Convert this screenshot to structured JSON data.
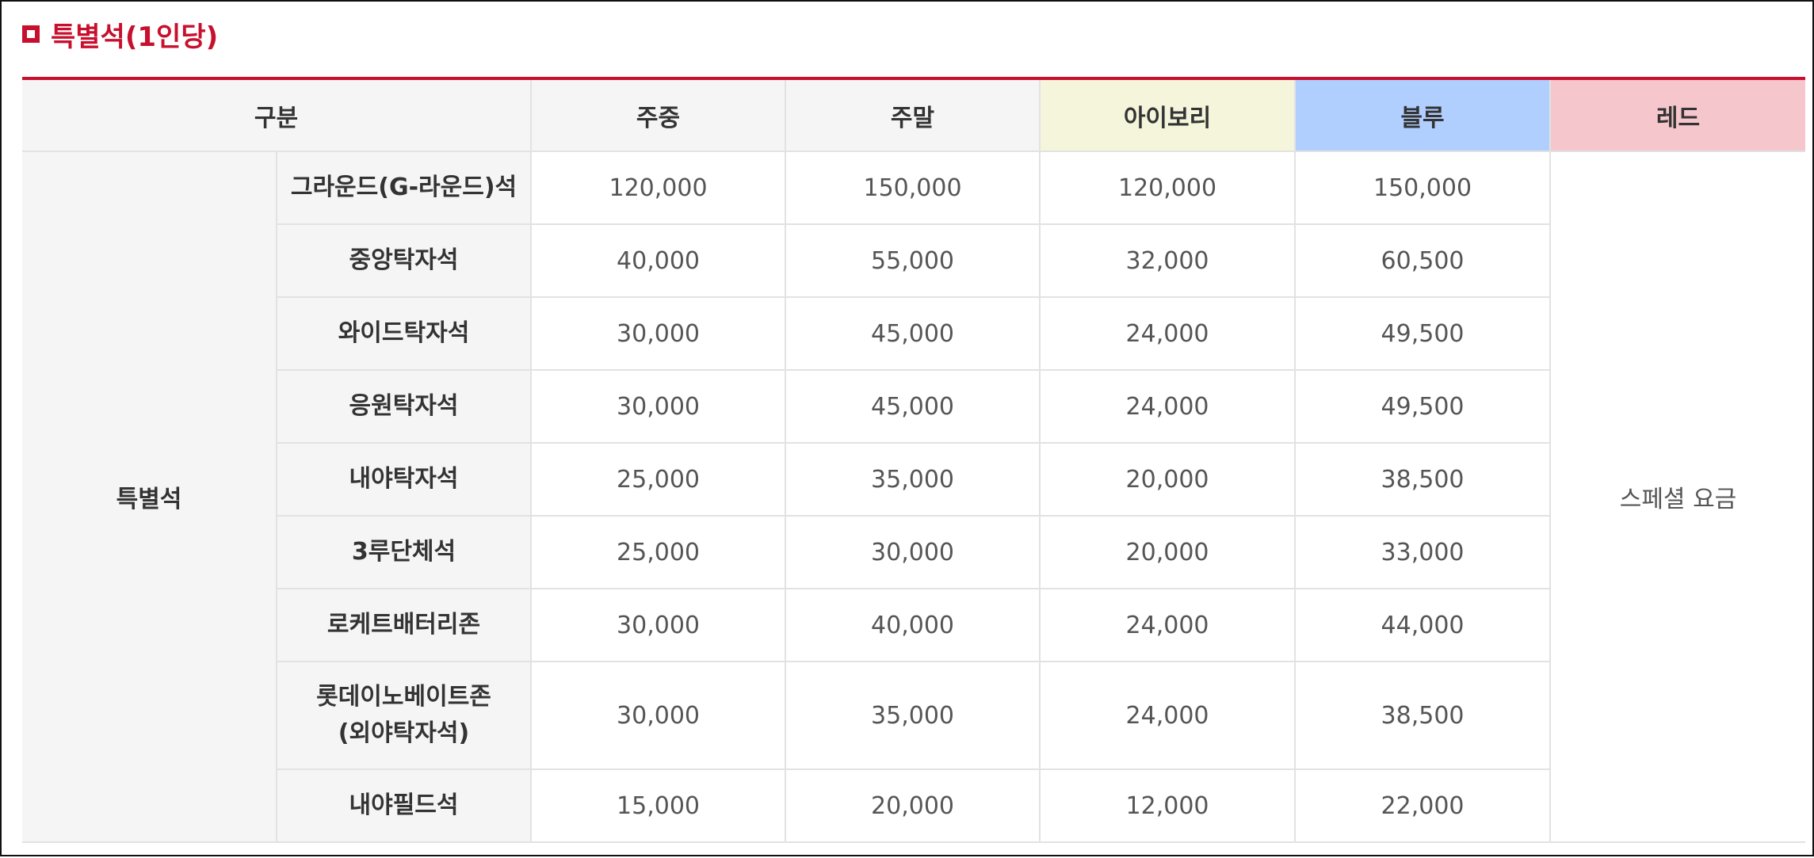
{
  "section": {
    "title": "특별석(1인당)",
    "icon": "square-bullet-icon",
    "accent_color": "#c8102e"
  },
  "table": {
    "headers": {
      "category": "구분",
      "weekday": "주중",
      "weekend": "주말",
      "ivory": "아이보리",
      "blue": "블루",
      "red": "레드"
    },
    "header_colors": {
      "ivory": "#f5f5dc",
      "blue": "#b0cfff",
      "red": "#f6c6cd"
    },
    "group_label": "특별석",
    "red_column_value": "스페셜 요금",
    "rows": [
      {
        "seat": "그라운드(G-라운드)석",
        "weekday": "120,000",
        "weekend": "150,000",
        "ivory": "120,000",
        "blue": "150,000"
      },
      {
        "seat": "중앙탁자석",
        "weekday": "40,000",
        "weekend": "55,000",
        "ivory": "32,000",
        "blue": "60,500"
      },
      {
        "seat": "와이드탁자석",
        "weekday": "30,000",
        "weekend": "45,000",
        "ivory": "24,000",
        "blue": "49,500"
      },
      {
        "seat": "응원탁자석",
        "weekday": "30,000",
        "weekend": "45,000",
        "ivory": "24,000",
        "blue": "49,500"
      },
      {
        "seat": "내야탁자석",
        "weekday": "25,000",
        "weekend": "35,000",
        "ivory": "20,000",
        "blue": "38,500"
      },
      {
        "seat": "3루단체석",
        "weekday": "25,000",
        "weekend": "30,000",
        "ivory": "20,000",
        "blue": "33,000"
      },
      {
        "seat": "로케트배터리존",
        "weekday": "30,000",
        "weekend": "40,000",
        "ivory": "24,000",
        "blue": "44,000"
      },
      {
        "seat_line1": "롯데이노베이트존",
        "seat_line2": "(외야탁자석)",
        "weekday": "30,000",
        "weekend": "35,000",
        "ivory": "24,000",
        "blue": "38,500"
      },
      {
        "seat": "내야필드석",
        "weekday": "15,000",
        "weekend": "20,000",
        "ivory": "12,000",
        "blue": "22,000"
      }
    ]
  }
}
